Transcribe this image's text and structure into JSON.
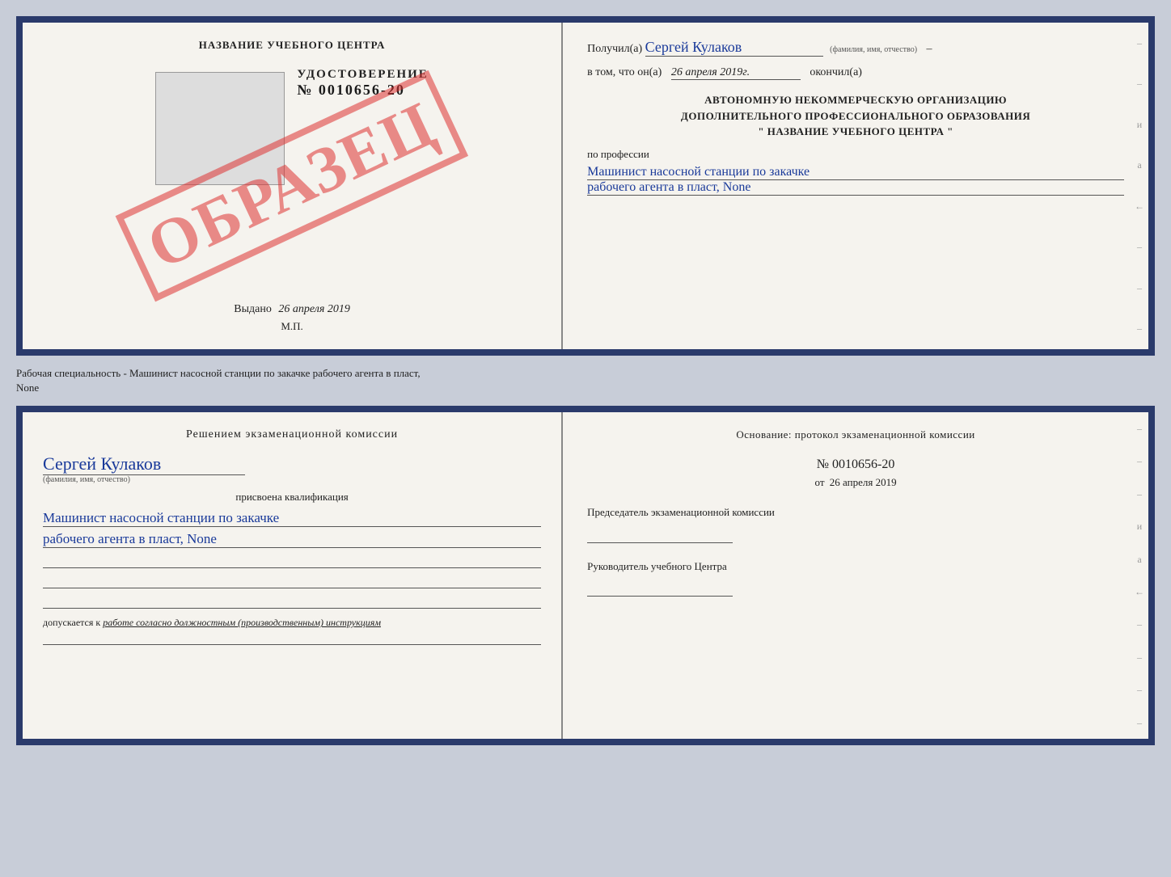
{
  "doc_top": {
    "left": {
      "org_name": "НАЗВАНИЕ УЧЕБНОГО ЦЕНТРА",
      "cert_title": "УДОСТОВЕРЕНИЕ",
      "cert_number": "№ 0010656-20",
      "issued_label": "Выдано",
      "issued_date": "26 апреля 2019",
      "mp_label": "М.П.",
      "obrazec": "ОБРАЗЕЦ"
    },
    "right": {
      "received_label": "Получил(а)",
      "received_name": "Сергей Кулаков",
      "received_subtitle": "(фамилия, имя, отчество)",
      "dash": "–",
      "date_label": "в том, что он(а)",
      "date_value": "26 апреля 2019г.",
      "finished_label": "окончил(а)",
      "org_line1": "АВТОНОМНУЮ НЕКОММЕРЧЕСКУЮ ОРГАНИЗАЦИЮ",
      "org_line2": "ДОПОЛНИТЕЛЬНОГО ПРОФЕССИОНАЛЬНОГО ОБРАЗОВАНИЯ",
      "org_line3": "\"   НАЗВАНИЕ УЧЕБНОГО ЦЕНТРА   \"",
      "profession_label": "по профессии",
      "profession_line1": "Машинист насосной станции по закачке",
      "profession_line2": "рабочего агента в пласт, None"
    }
  },
  "description": {
    "text1": "Рабочая специальность - Машинист насосной станции по закачке рабочего агента в пласт,",
    "text2": "None"
  },
  "doc_bottom": {
    "left": {
      "commission_title": "Решением экзаменационной комиссии",
      "person_name": "Сергей Кулаков",
      "name_subtitle": "(фамилия, имя, отчество)",
      "qual_label": "присвоена квалификация",
      "qual_line1": "Машинист насосной станции по закачке",
      "qual_line2": "рабочего агента в пласт, None",
      "допускается_label": "допускается к",
      "допускается_value": "работе согласно должностным (производственным) инструкциям"
    },
    "right": {
      "osnov_label": "Основание: протокол экзаменационной комиссии",
      "protocol_number": "№ 0010656-20",
      "protocol_date_prefix": "от",
      "protocol_date": "26 апреля 2019",
      "chairman_label": "Председатель экзаменационной комиссии",
      "director_label": "Руководитель учебного Центра"
    }
  }
}
